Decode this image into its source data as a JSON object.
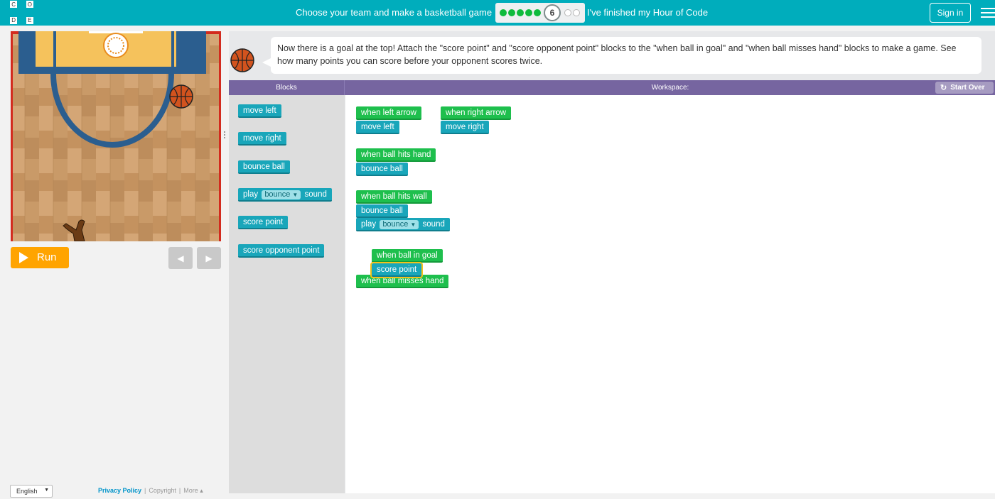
{
  "header": {
    "logo_letters": [
      "C",
      "O",
      "D",
      "E"
    ],
    "title": "Choose your team and make a basketball game",
    "progress": {
      "completed_levels": 5,
      "current_level": "6",
      "remaining_levels": 2
    },
    "finished_link": "I've finished my Hour of Code",
    "signin_label": "Sign in",
    "menu_icon": "hamburger-icon"
  },
  "play_area": {
    "run_label": "Run",
    "step_back_symbol": "◀",
    "step_forward_symbol": "▶"
  },
  "footer": {
    "language": "English",
    "privacy": "Privacy Policy",
    "separator": "|",
    "copyright": "Copyright",
    "more": "More ▴"
  },
  "instructions": {
    "text": "Now there is a goal at the top! Attach the \"score point\" and \"score opponent point\" blocks to the \"when ball in goal\" and \"when ball misses hand\" blocks to make a game. See how many points you can score before your opponent scores twice."
  },
  "headers": {
    "blocks": "Blocks",
    "workspace": "Workspace:",
    "start_over": "Start Over",
    "start_over_icon": "↻"
  },
  "toolbox": {
    "move_left": "move left",
    "move_right": "move right",
    "bounce_ball": "bounce ball",
    "play_prefix": "play",
    "play_sound": "bounce",
    "play_suffix": "sound",
    "score_point": "score point",
    "score_opponent_point": "score opponent point",
    "dropdown_arrow": "▼"
  },
  "workspace": {
    "when_left_arrow": "when left arrow",
    "move_left": "move left",
    "when_right_arrow": "when right arrow",
    "move_right": "move right",
    "when_ball_hits_hand": "when ball hits hand",
    "bounce_ball_1": "bounce ball",
    "when_ball_hits_wall": "when ball hits wall",
    "bounce_ball_2": "bounce ball",
    "play_prefix": "play",
    "play_sound": "bounce",
    "play_suffix": "sound",
    "when_ball_in_goal": "when ball in goal",
    "score_point": "score point",
    "when_ball_misses_hand": "when ball misses hand"
  },
  "colors": {
    "header_bg": "#00adbc",
    "run_button": "#ffa400",
    "progress_dot": "#0fbb3c",
    "event_block": "#1ebf4d",
    "action_block": "#19a6ba",
    "headers_bar": "#7665a0",
    "selected_outline": "#f5c21a"
  }
}
